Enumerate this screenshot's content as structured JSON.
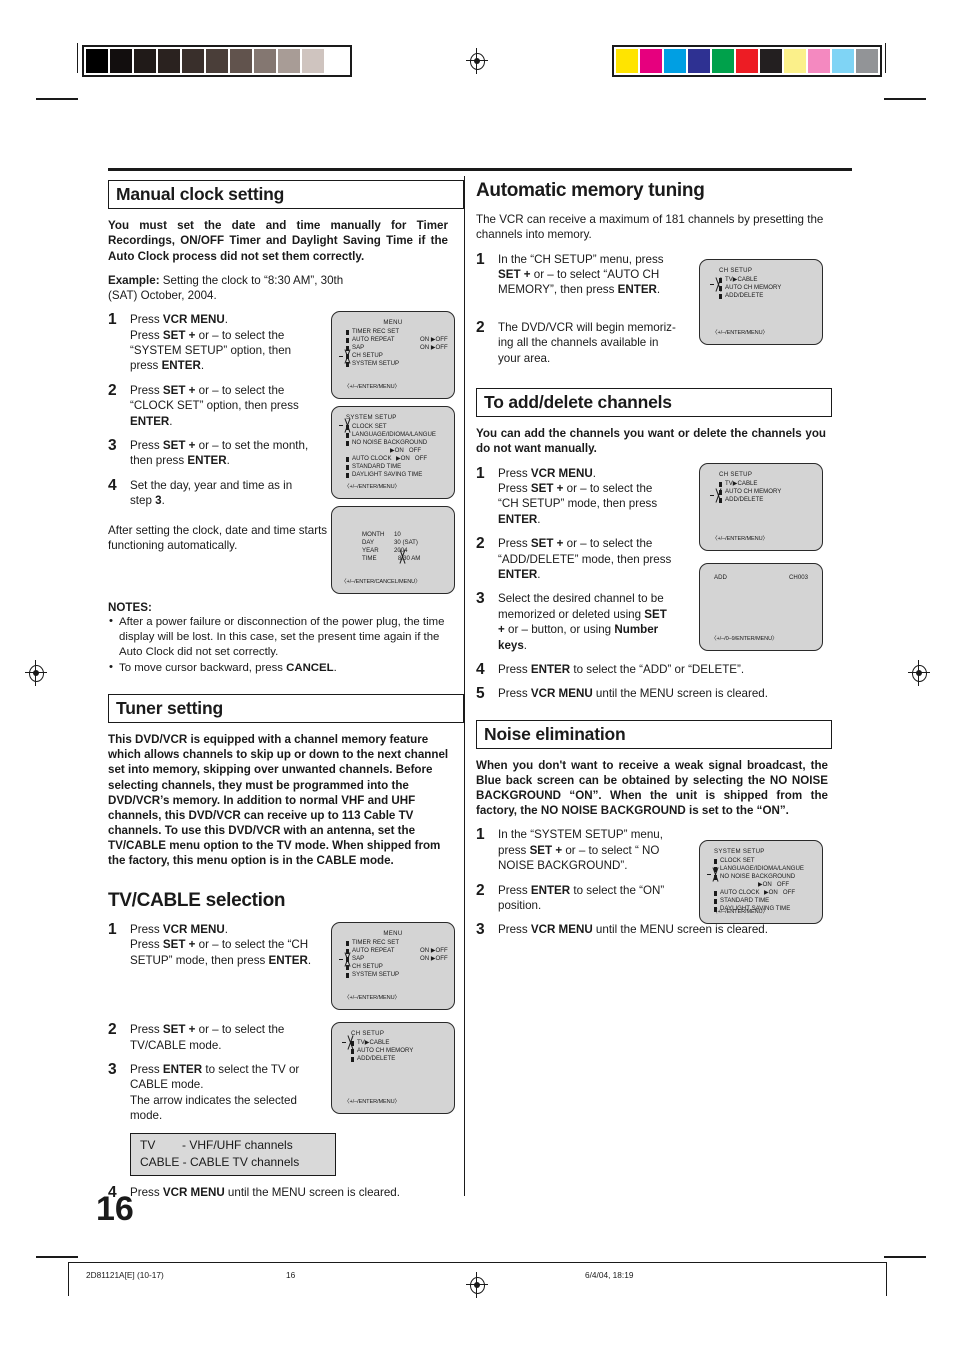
{
  "page": {
    "number": "16",
    "footer": {
      "code": "2D81121A[E] (10-17)",
      "page": "16",
      "date": "6/4/04, 18:19"
    }
  },
  "calibration": {
    "grayscale": [
      "#000000",
      "#120e0e",
      "#201a18",
      "#2a221f",
      "#392f2b",
      "#4a3e39",
      "#61534d",
      "#847771",
      "#a89c96",
      "#cfc4bf",
      "#ffffff"
    ],
    "colors": [
      "#ffe400",
      "#e6007e",
      "#009fe3",
      "#2e3192",
      "#00a14b",
      "#ed1c24",
      "#231f20",
      "#fbf08a",
      "#f489c0",
      "#7fd4f5",
      "#929497"
    ]
  },
  "left_column": {
    "manual_clock": {
      "title": "Manual clock setting",
      "intro": "You must set the date and time manually for Timer Recordings, ON/OFF Timer and Daylight Saving Time if the Auto Clock process did not set them correctly.",
      "example_label": "Example:",
      "example_text": " Setting the clock to “8:30 AM”, 30th (SAT) October, 2004.",
      "steps": [
        {
          "num": "1",
          "text": "Press VCR MENU. Press SET + or – to select the “SYSTEM SETUP” option, then press ENTER."
        },
        {
          "num": "2",
          "text": "Press SET + or – to select the “CLOCK SET” option, then press ENTER."
        },
        {
          "num": "3",
          "text": "Press SET + or – to set the month, then press ENTER."
        },
        {
          "num": "4",
          "text": "Set the day, year and time as in step 3."
        }
      ],
      "closing": "After setting the clock, date and time starts functioning automatically.",
      "notes_title": "NOTES:",
      "notes": [
        "After a power failure or disconnection of the power plug, the time display will be lost. In this case, set the present time again if the Auto Clock did not set correctly.",
        "To move cursor backward, press CANCEL."
      ]
    },
    "tuner_setting": {
      "title": "Tuner setting",
      "intro": "This DVD/VCR is equipped with a channel memory feature which allows channels to skip up or down to the next channel set into memory, skipping over unwanted channels. Before selecting channels, they must be programmed into the DVD/VCR’s memory. In addition to normal VHF and UHF channels, this DVD/VCR can receive up to 113 Cable TV channels. To use this DVD/VCR with an antenna, set the TV/CABLE menu option to the TV mode. When shipped from the factory, this menu option is in the CABLE mode."
    },
    "tv_cable": {
      "title": "TV/CABLE selection",
      "steps": [
        {
          "num": "1",
          "text": "Press VCR MENU. Press SET + or – to select the “CH SETUP” mode, then press ENTER."
        },
        {
          "num": "2",
          "text": "Press SET + or  – to select the TV/CABLE mode."
        },
        {
          "num": "3",
          "text": "Press ENTER to select the TV or CABLE mode. The arrow indicates the selected mode."
        },
        {
          "num": "4",
          "text": "Press VCR MENU until the MENU screen is cleared."
        }
      ],
      "mode_box": [
        "TV        - VHF/UHF channels",
        "CABLE - CABLE TV channels"
      ]
    }
  },
  "right_column": {
    "auto_memory": {
      "title": "Automatic memory tuning",
      "intro": "The VCR can receive a maximum of 181 channels by presetting the channels into memory.",
      "steps": [
        {
          "num": "1",
          "text": "In the “CH SETUP” menu, press SET + or – to select “AUTO CH MEMORY”, then press ENTER."
        },
        {
          "num": "2",
          "text": "The DVD/VCR will begin memorizing all the channels available in your area."
        }
      ]
    },
    "add_delete": {
      "title": "To add/delete channels",
      "intro": "You can add the channels you want or delete the channels you do not want manually.",
      "steps": [
        {
          "num": "1",
          "text": "Press VCR MENU. Press SET + or – to select the “CH SETUP” mode, then press ENTER."
        },
        {
          "num": "2",
          "text": "Press SET + or – to select the “ADD/DELETE” mode, then press ENTER."
        },
        {
          "num": "3",
          "text": "Select the desired channel to be memorized or deleted using SET + or – button, or using Number keys."
        },
        {
          "num": "4",
          "text": "Press ENTER to select the “ADD” or “DELETE”."
        },
        {
          "num": "5",
          "text": "Press VCR MENU until the MENU screen is cleared."
        }
      ]
    },
    "noise_elimination": {
      "title": "Noise elimination",
      "intro": "When you don't want to receive a weak signal broadcast, the Blue back screen can be obtained by selecting the NO NOISE BACKGROUND “ON”. When the unit is shipped from the factory, the NO NOISE BACKGROUND is set to the “ON”.",
      "steps": [
        {
          "num": "1",
          "text": "In the “SYSTEM SETUP” menu, press SET + or – to select “ NO NOISE BACKGROUND”."
        },
        {
          "num": "2",
          "text": "Press ENTER to select the “ON” position."
        },
        {
          "num": "3",
          "text": "Press VCR MENU until the MENU screen is cleared."
        }
      ]
    }
  },
  "osd_screens": {
    "menu_system_setup": {
      "head": "MENU",
      "items": [
        "TIMER REC SET",
        "AUTO REPEAT",
        "SAP",
        "CH SETUP",
        "SYSTEM SETUP"
      ],
      "auto_repeat_value": "ON ▶OFF",
      "sap_value": "ON ▶OFF",
      "footer": "〈+/–/ENTER/MENU〉"
    },
    "system_setup_clock": {
      "head": "SYSTEM SETUP",
      "items": [
        "CLOCK SET",
        "LANGUAGE/IDIOMA/LANGUE",
        "NO NOISE BACKGROUND",
        "AUTO CLOCK",
        "STANDARD TIME",
        "DAYLIGHT SAVING TIME"
      ],
      "no_noise_value": "▶ON   OFF",
      "auto_clock_value": "▶ON   OFF",
      "footer": "〈+/–/ENTER/MENU〉"
    },
    "clock_set": {
      "rows": [
        {
          "label": "MONTH",
          "value": "10"
        },
        {
          "label": "DAY",
          "value": "30 (SAT)"
        },
        {
          "label": "YEAR",
          "value": "2004"
        },
        {
          "label": "TIME",
          "value": "8:30 AM"
        }
      ],
      "footer": "〈+/–/ENTER/CANCEL/MENU〉"
    },
    "menu_ch_setup": {
      "head": "MENU",
      "items": [
        "TIMER REC SET",
        "AUTO REPEAT",
        "SAP",
        "CH SETUP",
        "SYSTEM SETUP"
      ],
      "auto_repeat_value": "ON ▶OFF",
      "sap_value": "ON ▶OFF",
      "footer": "〈+/–/ENTER/MENU〉"
    },
    "ch_setup_tvcable": {
      "head": "CH SETUP",
      "items": [
        "TV▶CABLE",
        "AUTO CH MEMORY",
        "ADD/DELETE"
      ],
      "footer": "〈+/–/ENTER/MENU〉"
    },
    "ch_setup_auto": {
      "head": "CH SETUP",
      "items": [
        "TV▶CABLE",
        "AUTO CH MEMORY",
        "ADD/DELETE"
      ],
      "footer": "〈+/–/ENTER/MENU〉"
    },
    "ch_setup_adddelete": {
      "head": "CH SETUP",
      "items": [
        "TV▶CABLE",
        "AUTO CH MEMORY",
        "ADD/DELETE"
      ],
      "footer": "〈+/–/ENTER/MENU〉"
    },
    "add_channel": {
      "label": "ADD",
      "channel": "CH003",
      "footer": "〈+/–/0–9/ENTER/MENU〉"
    },
    "system_setup_noise": {
      "head": "SYSTEM SETUP",
      "items": [
        "CLOCK SET",
        "LANGUAGE/IDIOMA/LANGUE",
        "NO NOISE BACKGROUND",
        "AUTO CLOCK",
        "STANDARD TIME",
        "DAYLIGHT SAVING TIME"
      ],
      "no_noise_value": "▶ON   OFF",
      "auto_clock_value": "▶ON   OFF",
      "footer": "〈+/–/ENTER/MENU〉"
    }
  }
}
